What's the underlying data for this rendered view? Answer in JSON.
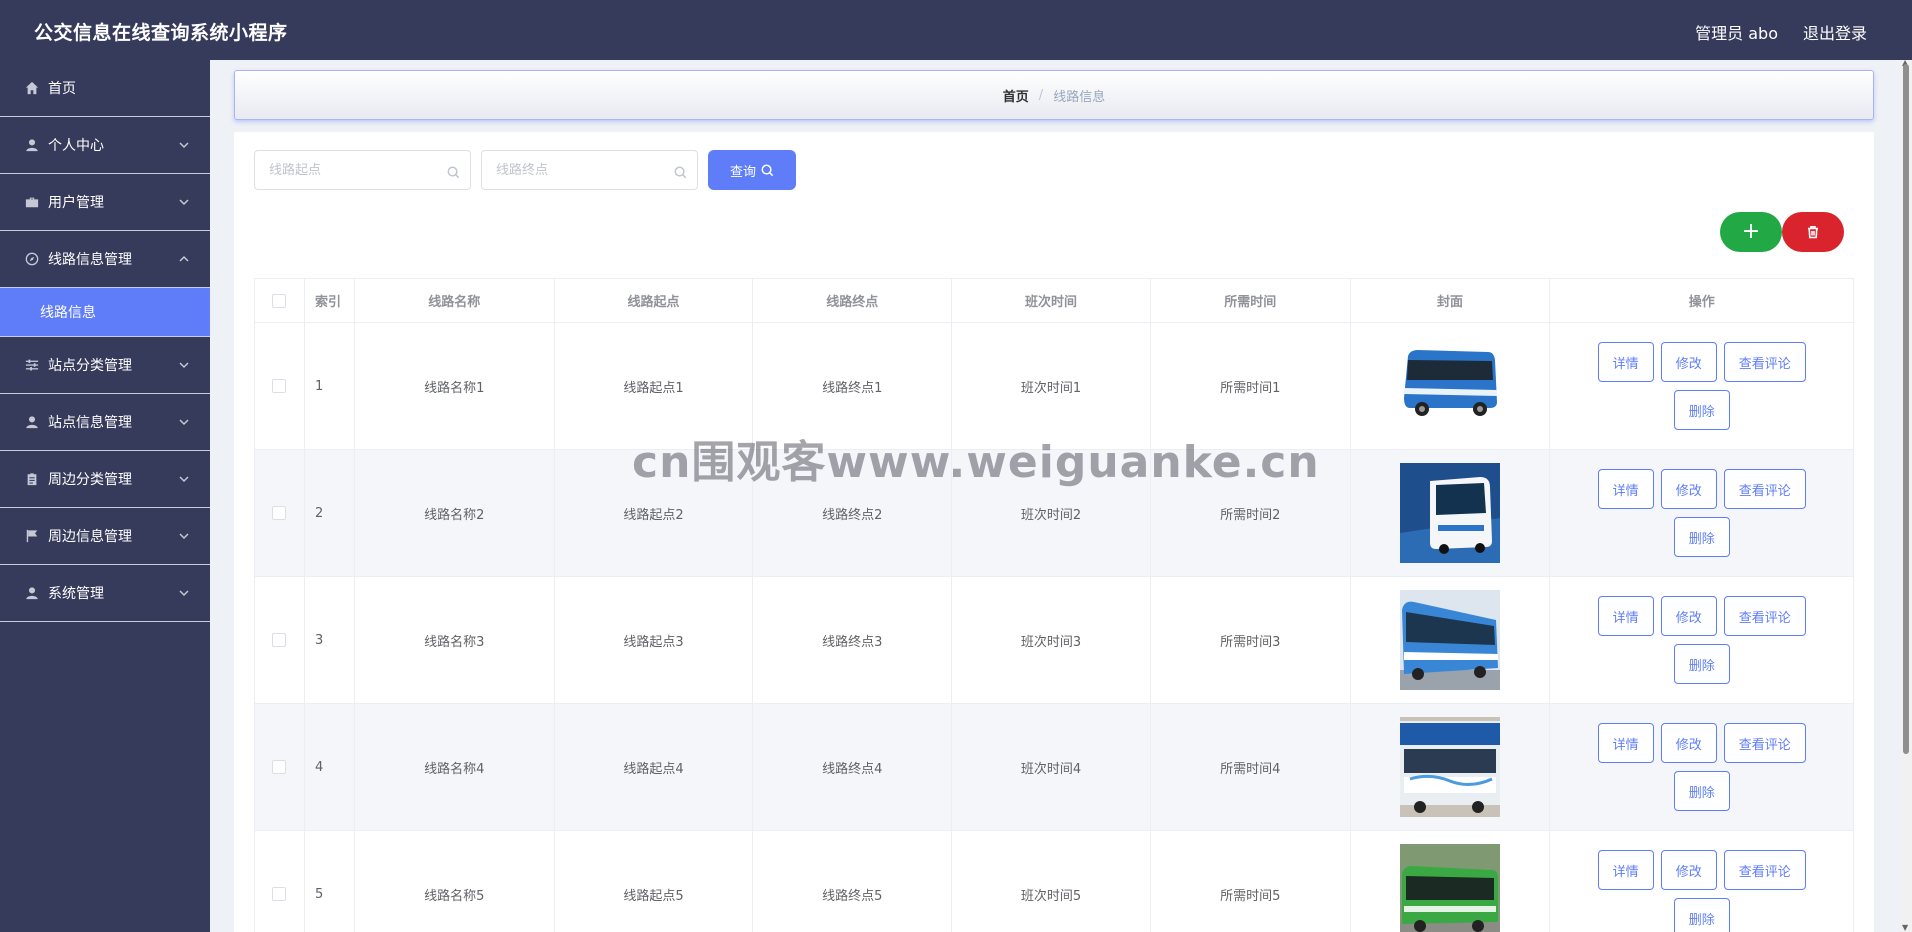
{
  "header": {
    "title": "公交信息在线查询系统小程序",
    "user": "管理员 abo",
    "logout": "退出登录"
  },
  "sidebar": {
    "items": [
      {
        "label": "首页",
        "icon": "home-icon",
        "expandable": false
      },
      {
        "label": "个人中心",
        "icon": "user-icon",
        "expandable": true
      },
      {
        "label": "用户管理",
        "icon": "briefcase-icon",
        "expandable": true
      },
      {
        "label": "线路信息管理",
        "icon": "compass-icon",
        "expandable": true,
        "expanded": true
      },
      {
        "label": "站点分类管理",
        "icon": "sliders-icon",
        "expandable": true
      },
      {
        "label": "站点信息管理",
        "icon": "user-icon",
        "expandable": true
      },
      {
        "label": "周边分类管理",
        "icon": "clipboard-icon",
        "expandable": true
      },
      {
        "label": "周边信息管理",
        "icon": "flag-icon",
        "expandable": true
      },
      {
        "label": "系统管理",
        "icon": "user-icon",
        "expandable": true
      }
    ],
    "active_sub": "线路信息"
  },
  "breadcrumb": {
    "home": "首页",
    "separator": "/",
    "current": "线路信息"
  },
  "search": {
    "start_placeholder": "线路起点",
    "end_placeholder": "线路终点",
    "query_label": "查询"
  },
  "actions": {
    "add": "+",
    "add_color": "#22a845",
    "delete_color": "#d9232d"
  },
  "table": {
    "columns": [
      "索引",
      "线路名称",
      "线路起点",
      "线路终点",
      "班次时间",
      "所需时间",
      "封面",
      "操作"
    ],
    "rows": [
      {
        "index": "1",
        "name": "线路名称1",
        "start": "线路起点1",
        "end": "线路终点1",
        "schedule": "班次时间1",
        "duration": "所需时间1"
      },
      {
        "index": "2",
        "name": "线路名称2",
        "start": "线路起点2",
        "end": "线路终点2",
        "schedule": "班次时间2",
        "duration": "所需时间2"
      },
      {
        "index": "3",
        "name": "线路名称3",
        "start": "线路起点3",
        "end": "线路终点3",
        "schedule": "班次时间3",
        "duration": "所需时间3"
      },
      {
        "index": "4",
        "name": "线路名称4",
        "start": "线路起点4",
        "end": "线路终点4",
        "schedule": "班次时间4",
        "duration": "所需时间4"
      },
      {
        "index": "5",
        "name": "线路名称5",
        "start": "线路起点5",
        "end": "线路终点5",
        "schedule": "班次时间5",
        "duration": "所需时间5"
      }
    ],
    "ops": {
      "detail": "详情",
      "edit": "修改",
      "comments": "查看评论",
      "delete": "删除"
    }
  },
  "watermark": "cn围观客www.weiguanke.cn",
  "colors": {
    "sidebar_bg": "#363a5b",
    "accent": "#5f7df9"
  }
}
